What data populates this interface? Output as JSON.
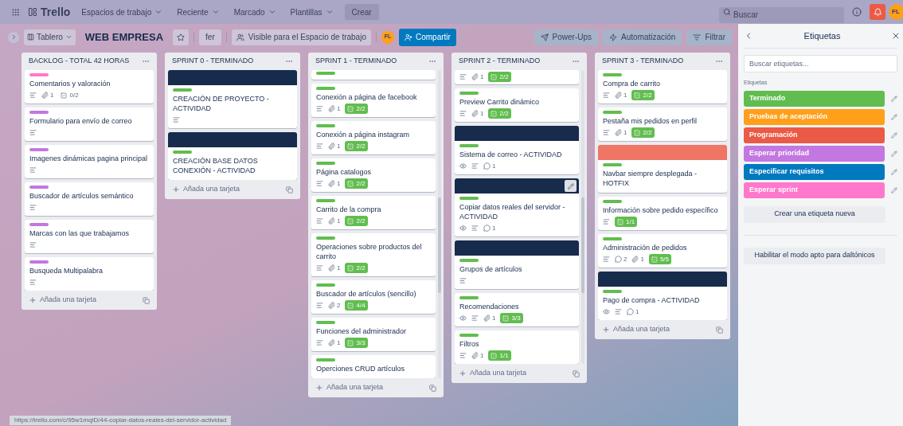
{
  "topbar": {
    "logo": "Trello",
    "menus": [
      {
        "label": "Espacios de trabajo"
      },
      {
        "label": "Reciente"
      },
      {
        "label": "Marcado"
      },
      {
        "label": "Plantillas"
      }
    ],
    "create": "Crear",
    "search": {
      "placeholder": "Buscar"
    },
    "avatar": "FL"
  },
  "board_header": {
    "view": "Tablero",
    "title": "WEB EMPRESA",
    "starred": false,
    "workspace": "fer",
    "visibility": "Visible para el Espacio de trabajo",
    "member": "FL",
    "share": "Compartir",
    "actions": [
      {
        "kind": "powerups",
        "label": "Power-Ups"
      },
      {
        "kind": "automation",
        "label": "Automatización"
      },
      {
        "kind": "filter",
        "label": "Filtrar"
      }
    ]
  },
  "lists": [
    {
      "title": "BACKLOG - TOTAL 42 HORAS",
      "scrollable": false,
      "add": "Añada una tarjeta",
      "cards": [
        {
          "label": {
            "color": "#ff78cb"
          },
          "title": "Comentarios y valoración",
          "badges": [
            {
              "kind": "description"
            },
            {
              "kind": "attachment",
              "text": "1"
            },
            {
              "kind": "checklist",
              "text": "0/2",
              "complete": false
            }
          ]
        },
        {
          "label": {
            "color": "#c377e0"
          },
          "title": "Formulario para envío de correo",
          "badges": [
            {
              "kind": "description"
            }
          ]
        },
        {
          "label": {
            "color": "#c377e0"
          },
          "title": "Imagenes dinámicas pagina principal",
          "badges": [
            {
              "kind": "description"
            }
          ]
        },
        {
          "label": {
            "color": "#c377e0"
          },
          "title": "Buscador de artículos semántico",
          "badges": [
            {
              "kind": "description"
            }
          ]
        },
        {
          "label": {
            "color": "#c377e0"
          },
          "title": "Marcas con las que trabajamos",
          "badges": [
            {
              "kind": "description"
            }
          ]
        },
        {
          "label": {
            "color": "#c377e0"
          },
          "title": "Busqueda Multipalabra",
          "badges": [
            {
              "kind": "description"
            }
          ]
        }
      ]
    },
    {
      "title": "SPRINT 0 - TERMINADO",
      "scrollable": false,
      "add": "Añada una tarjeta",
      "cards": [
        {
          "cover": {
            "color": "#172b4d"
          },
          "label": {
            "color": "#61bd4f"
          },
          "title": "CREACIÓN DE PROYECTO - ACTIVIDAD",
          "badges": [
            {
              "kind": "description"
            }
          ]
        },
        {
          "cover": {
            "color": "#172b4d"
          },
          "label": {
            "color": "#61bd4f"
          },
          "title": "CREACIÓN BASE DATOS CONEXIÓN - ACTIVIDAD"
        }
      ]
    },
    {
      "title": "SPRINT 1 - TERMINADO",
      "scrollable": true,
      "add": "Añada una tarjeta",
      "cards": [
        {
          "label": {
            "color": "#61bd4f"
          },
          "cut": true
        },
        {
          "label": {
            "color": "#61bd4f"
          },
          "title": "Conexión a página de facebook",
          "badges": [
            {
              "kind": "description"
            },
            {
              "kind": "attachment",
              "text": "1"
            },
            {
              "kind": "checklist",
              "text": "2/2",
              "complete": true
            }
          ]
        },
        {
          "label": {
            "color": "#61bd4f"
          },
          "title": "Conexión a página instagram",
          "badges": [
            {
              "kind": "description"
            },
            {
              "kind": "attachment",
              "text": "1"
            },
            {
              "kind": "checklist",
              "text": "2/2",
              "complete": true
            }
          ]
        },
        {
          "label": {
            "color": "#61bd4f"
          },
          "title": "Página catalogos",
          "badges": [
            {
              "kind": "description"
            },
            {
              "kind": "attachment",
              "text": "1"
            },
            {
              "kind": "checklist",
              "text": "2/2",
              "complete": true
            }
          ]
        },
        {
          "label": {
            "color": "#61bd4f"
          },
          "title": "Carrito de la compra",
          "badges": [
            {
              "kind": "description"
            },
            {
              "kind": "attachment",
              "text": "1"
            },
            {
              "kind": "checklist",
              "text": "2/2",
              "complete": true
            }
          ]
        },
        {
          "label": {
            "color": "#61bd4f"
          },
          "title": "Operaciones sobre productos del carrito",
          "badges": [
            {
              "kind": "description"
            },
            {
              "kind": "attachment",
              "text": "1"
            },
            {
              "kind": "checklist",
              "text": "2/2",
              "complete": true
            }
          ]
        },
        {
          "label": {
            "color": "#61bd4f"
          },
          "title": "Buscador de artículos (sencillo)",
          "badges": [
            {
              "kind": "description"
            },
            {
              "kind": "attachment",
              "text": "2"
            },
            {
              "kind": "checklist",
              "text": "4/4",
              "complete": true
            }
          ]
        },
        {
          "label": {
            "color": "#61bd4f"
          },
          "title": "Funciones del administrador",
          "badges": [
            {
              "kind": "description"
            },
            {
              "kind": "attachment",
              "text": "1"
            },
            {
              "kind": "checklist",
              "text": "3/3",
              "complete": true
            }
          ]
        },
        {
          "label": {
            "color": "#61bd4f"
          },
          "title": "Operciones CRUD artículos"
        }
      ]
    },
    {
      "title": "SPRINT 2 - TERMINADO",
      "scrollable": true,
      "add": "Añada una tarjeta",
      "cards": [
        {
          "cut": true,
          "badges": [
            {
              "kind": "description"
            },
            {
              "kind": "attachment",
              "text": "1"
            },
            {
              "kind": "checklist",
              "text": "2/2",
              "complete": true
            }
          ]
        },
        {
          "label": {
            "color": "#61bd4f"
          },
          "title": "Preview Carrito dinámico",
          "badges": [
            {
              "kind": "description"
            },
            {
              "kind": "attachment",
              "text": "1"
            },
            {
              "kind": "checklist",
              "text": "2/2",
              "complete": true
            }
          ]
        },
        {
          "cover": {
            "color": "#172b4d"
          },
          "label": {
            "color": "#61bd4f"
          },
          "title": "Sistema de correo - ACTIVIDAD",
          "badges": [
            {
              "kind": "watch"
            },
            {
              "kind": "description"
            },
            {
              "kind": "comment",
              "text": "1"
            }
          ]
        },
        {
          "cover": {
            "color": "#172b4d"
          },
          "hovered": true,
          "label": {
            "color": "#61bd4f"
          },
          "title": "Copiar datos reales del servidor - ACTIVIDAD",
          "badges": [
            {
              "kind": "watch"
            },
            {
              "kind": "description"
            },
            {
              "kind": "comment",
              "text": "1"
            }
          ]
        },
        {
          "cover": {
            "color": "#172b4d"
          },
          "label": {
            "color": "#61bd4f"
          },
          "title": "Grupos de artículos",
          "badges": [
            {
              "kind": "description"
            }
          ]
        },
        {
          "label": {
            "color": "#61bd4f"
          },
          "title": "Recomendaciones",
          "badges": [
            {
              "kind": "watch"
            },
            {
              "kind": "description"
            },
            {
              "kind": "attachment",
              "text": "1"
            },
            {
              "kind": "checklist",
              "text": "3/3",
              "complete": true
            }
          ]
        },
        {
          "label": {
            "color": "#61bd4f"
          },
          "title": "Filtros",
          "badges": [
            {
              "kind": "description"
            },
            {
              "kind": "attachment",
              "text": "1"
            },
            {
              "kind": "checklist",
              "text": "1/1",
              "complete": true
            }
          ]
        }
      ]
    },
    {
      "title": "SPRINT 3 - TERMINADO",
      "scrollable": false,
      "add": "Añada una tarjeta",
      "cards": [
        {
          "label": {
            "color": "#61bd4f"
          },
          "title": "Compra de carrito",
          "badges": [
            {
              "kind": "description"
            },
            {
              "kind": "attachment",
              "text": "1"
            },
            {
              "kind": "checklist",
              "text": "2/2",
              "complete": true
            }
          ]
        },
        {
          "label": {
            "color": "#61bd4f"
          },
          "title": "Pestaña mis pedidos en perfil",
          "badges": [
            {
              "kind": "description"
            },
            {
              "kind": "attachment",
              "text": "1"
            },
            {
              "kind": "checklist",
              "text": "2/2",
              "complete": true
            }
          ]
        },
        {
          "cover": {
            "color": "#ef7564"
          },
          "label": {
            "color": "#61bd4f"
          },
          "title": "Navbar siempre desplegada - HOTFIX"
        },
        {
          "label": {
            "color": "#61bd4f"
          },
          "title": "Información sobre pedido específico",
          "badges": [
            {
              "kind": "description"
            },
            {
              "kind": "checklist",
              "text": "1/1",
              "complete": true
            }
          ]
        },
        {
          "label": {
            "color": "#61bd4f"
          },
          "title": "Administración de pedidos",
          "badges": [
            {
              "kind": "description"
            },
            {
              "kind": "comment",
              "text": "2"
            },
            {
              "kind": "attachment",
              "text": "1"
            },
            {
              "kind": "checklist",
              "text": "5/5",
              "complete": true
            }
          ]
        },
        {
          "cover": {
            "color": "#172b4d"
          },
          "label": {
            "color": "#61bd4f"
          },
          "title": "Pago de compra - ACTIVIDAD",
          "badges": [
            {
              "kind": "watch"
            },
            {
              "kind": "description"
            },
            {
              "kind": "comment",
              "text": "1"
            }
          ]
        }
      ]
    }
  ],
  "labels_panel": {
    "title": "Etiquetas",
    "search": {
      "placeholder": "Buscar etiquetas..."
    },
    "section": "Etiquetas",
    "labels": [
      {
        "name": "Terminado",
        "color": "#61bd4f"
      },
      {
        "name": "Pruebas de aceptación",
        "color": "#ff9f1a"
      },
      {
        "name": "Programación",
        "color": "#eb5a46"
      },
      {
        "name": "Esperar prioridad",
        "color": "#c377e0"
      },
      {
        "name": "Especificar requisitos",
        "color": "#0079bf"
      },
      {
        "name": "Esperar sprint",
        "color": "#ff78cb"
      }
    ],
    "create": "Crear una etiqueta nueva",
    "colorblind": "Habilitar el modo apto para daltónicos"
  },
  "status_url": "https://trello.com/c/95w1mqID/44-copiar-datos-reales-del-servidor-actividad"
}
